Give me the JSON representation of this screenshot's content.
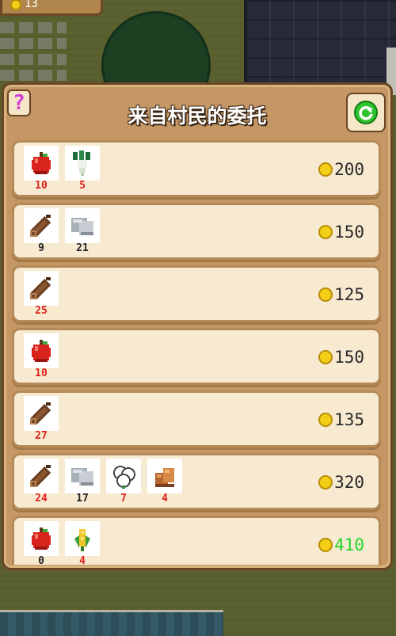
{
  "hud": {
    "coins": "13"
  },
  "panel": {
    "title": "来自村民的委托",
    "help_label": "?"
  },
  "colors": {
    "qty_short": "#e0201c",
    "qty_enough": "#222222",
    "reward_affordable": "#22d42a"
  },
  "quests": [
    {
      "items": [
        {
          "icon": "apple-icon",
          "qty": "10",
          "enough": false
        },
        {
          "icon": "radish-icon",
          "qty": "5",
          "enough": false
        }
      ],
      "reward": "200",
      "highlight": false
    },
    {
      "items": [
        {
          "icon": "wood-log-icon",
          "qty": "9",
          "enough": true
        },
        {
          "icon": "stone-icon",
          "qty": "21",
          "enough": true
        }
      ],
      "reward": "150",
      "highlight": false
    },
    {
      "items": [
        {
          "icon": "wood-log-icon",
          "qty": "25",
          "enough": false
        }
      ],
      "reward": "125",
      "highlight": false
    },
    {
      "items": [
        {
          "icon": "apple-icon",
          "qty": "10",
          "enough": false
        }
      ],
      "reward": "150",
      "highlight": false
    },
    {
      "items": [
        {
          "icon": "wood-log-icon",
          "qty": "27",
          "enough": false
        }
      ],
      "reward": "135",
      "highlight": false
    },
    {
      "items": [
        {
          "icon": "wood-log-icon",
          "qty": "24",
          "enough": false
        },
        {
          "icon": "stone-icon",
          "qty": "17",
          "enough": true
        },
        {
          "icon": "cotton-icon",
          "qty": "7",
          "enough": false
        },
        {
          "icon": "copper-ore-icon",
          "qty": "4",
          "enough": false
        }
      ],
      "reward": "320",
      "highlight": false
    },
    {
      "items": [
        {
          "icon": "apple-icon",
          "qty": "0",
          "enough": true
        },
        {
          "icon": "corn-icon",
          "qty": "4",
          "enough": false
        }
      ],
      "reward": "410",
      "highlight": true
    }
  ]
}
